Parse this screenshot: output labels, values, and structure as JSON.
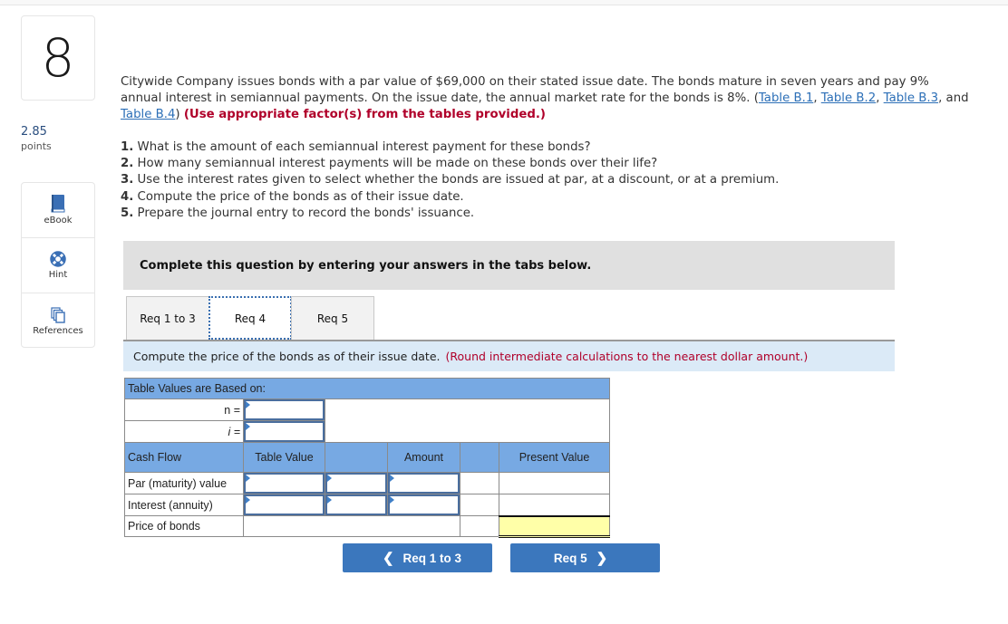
{
  "question": {
    "number": "8",
    "points_value": "2.85",
    "points_label": "points"
  },
  "tools": [
    {
      "icon": "book-icon",
      "label": "eBook"
    },
    {
      "icon": "lifebuoy-icon",
      "label": "Hint"
    },
    {
      "icon": "copies-icon",
      "label": "References"
    }
  ],
  "problem": {
    "text_part1": "Citywide Company issues bonds with a par value of $69,000 on their stated issue date. The bonds mature in seven years and pay 9% annual interest in semiannual payments. On the issue date, the annual market rate for the bonds is 8%. (",
    "links": [
      "Table B.1",
      "Table B.2",
      "Table B.3",
      "Table B.4"
    ],
    "sep1": ", ",
    "sep_and": ", and ",
    "close_paren": ")",
    "note": "(Use appropriate factor(s) from the tables provided.)"
  },
  "requirements": [
    {
      "num": "1.",
      "text": "What is the amount of each semiannual interest payment for these bonds?"
    },
    {
      "num": "2.",
      "text": "How many semiannual interest payments will be made on these bonds over their life?"
    },
    {
      "num": "3.",
      "text": "Use the interest rates given to select whether the bonds are issued at par, at a discount, or at a premium."
    },
    {
      "num": "4.",
      "text": "Compute the price of the bonds as of their issue date."
    },
    {
      "num": "5.",
      "text": "Prepare the journal entry to record the bonds' issuance."
    }
  ],
  "instruction": "Complete this question by entering your answers in the tabs below.",
  "tabs": [
    {
      "label": "Req 1 to 3",
      "active": false
    },
    {
      "label": "Req 4",
      "active": true
    },
    {
      "label": "Req 5",
      "active": false
    }
  ],
  "prompt": {
    "text": "Compute the price of the bonds as of their issue date.",
    "note": "(Round intermediate calculations to the nearest dollar amount.)"
  },
  "worksheet": {
    "title": "Table Values are Based on:",
    "n_label": "n =",
    "i_label": "i =",
    "n_value": "",
    "i_value": "",
    "headers": {
      "cash_flow": "Cash Flow",
      "table_value": "Table Value",
      "amount": "Amount",
      "present_value": "Present Value"
    },
    "rows": [
      {
        "label": "Par (maturity) value",
        "table_value": "",
        "table_value_2": "",
        "amount": "",
        "present_value": ""
      },
      {
        "label": "Interest (annuity)",
        "table_value": "",
        "table_value_2": "",
        "amount": "",
        "present_value": ""
      }
    ],
    "total_label": "Price of bonds",
    "total_value": ""
  },
  "nav": {
    "prev_label": "Req 1 to 3",
    "next_label": "Req 5"
  }
}
